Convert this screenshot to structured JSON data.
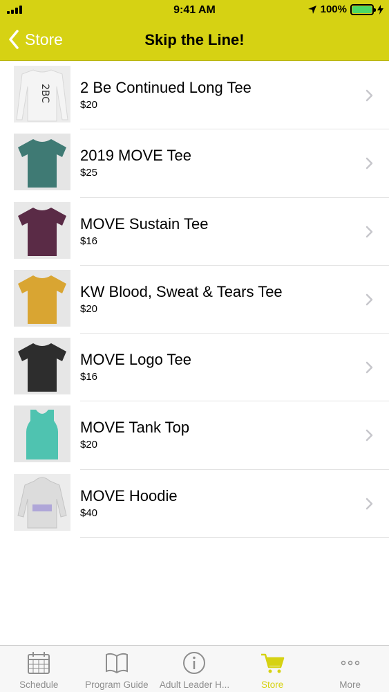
{
  "status_bar": {
    "time": "9:41 AM",
    "battery": "100%"
  },
  "nav": {
    "back_label": "Store",
    "title": "Skip the Line!"
  },
  "colors": {
    "accent": "#d6d213",
    "tab_inactive": "#8e8e8e"
  },
  "products": [
    {
      "name": "2 Be Continued Long Tee",
      "price": "$20",
      "shirt_color": "#f4f4f4",
      "thumb_bg": "#ececec"
    },
    {
      "name": "2019 MOVE Tee",
      "price": "$25",
      "shirt_color": "#3f7a74",
      "thumb_bg": "#e5e5e5"
    },
    {
      "name": "MOVE Sustain Tee",
      "price": "$16",
      "shirt_color": "#5a2b46",
      "thumb_bg": "#e8e8e8"
    },
    {
      "name": "KW Blood, Sweat & Tears Tee",
      "price": "$20",
      "shirt_color": "#d9a532",
      "thumb_bg": "#e6e6e6"
    },
    {
      "name": "MOVE Logo Tee",
      "price": "$16",
      "shirt_color": "#2d2d2d",
      "thumb_bg": "#e6e6e6"
    },
    {
      "name": "MOVE Tank Top",
      "price": "$20",
      "shirt_color": "#4fc3b0",
      "thumb_bg": "#e6e6e6"
    },
    {
      "name": "MOVE Hoodie",
      "price": "$40",
      "shirt_color": "#dcdcdc",
      "thumb_bg": "#ececec"
    }
  ],
  "tabs": [
    {
      "label": "Schedule",
      "icon": "calendar-icon"
    },
    {
      "label": "Program Guide",
      "icon": "book-icon"
    },
    {
      "label": "Adult Leader H...",
      "icon": "info-icon"
    },
    {
      "label": "Store",
      "icon": "cart-icon",
      "active": true
    },
    {
      "label": "More",
      "icon": "more-icon"
    }
  ]
}
